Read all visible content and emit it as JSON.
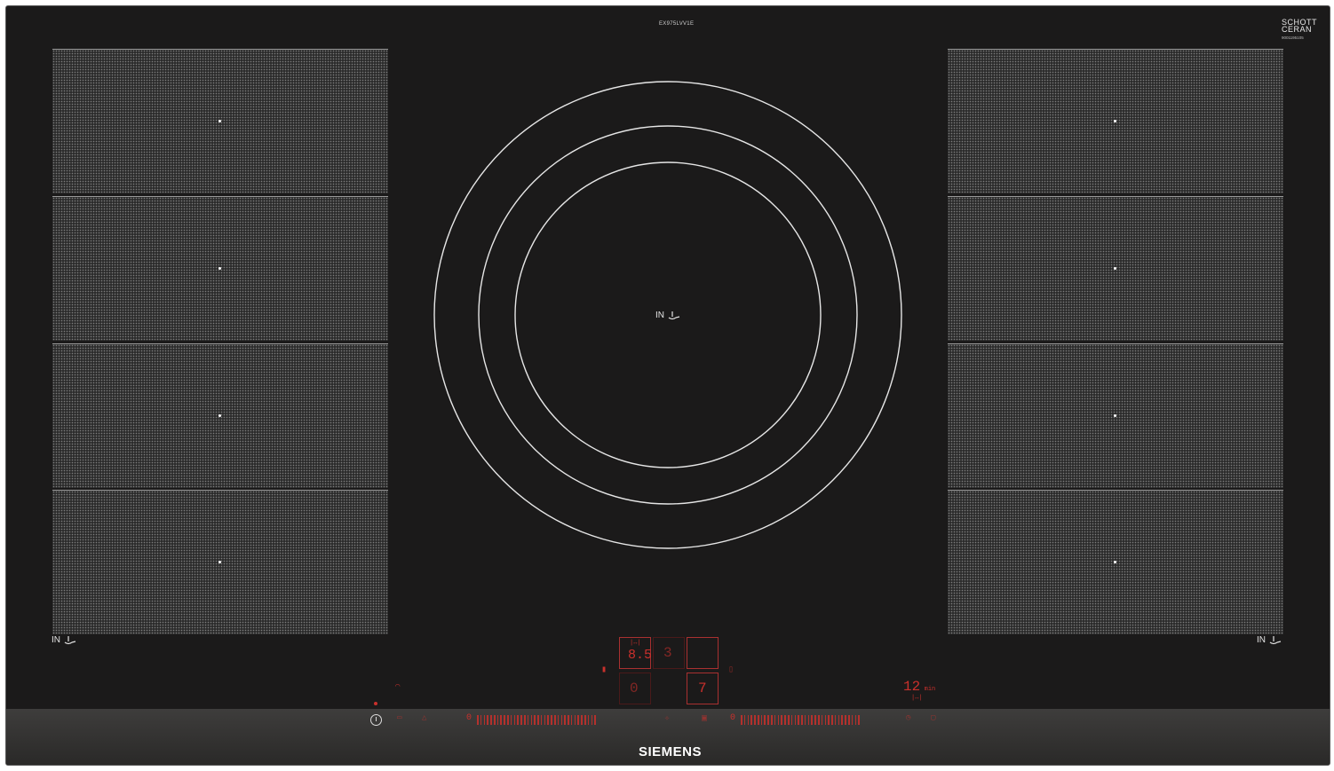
{
  "hob": {
    "model": "EX975LVV1E",
    "glass_brand": {
      "line1": "SCHOTT",
      "line2": "CERAN",
      "serial": "9001195105"
    },
    "zone_label": "IN",
    "icon_steam": "pot-steam-icon",
    "colors": {
      "glass": "#1b1a1a",
      "zone_pattern": "#7d7d7d",
      "display_red": "#c9302c",
      "circle": "#e6e6e6"
    }
  },
  "displays": {
    "level_a": "8.5",
    "level_b": "3",
    "level_c": "0",
    "level_d": "7",
    "timer_value": "12",
    "timer_unit": "min"
  },
  "sliders": {
    "left_start": "0",
    "right_start": "0"
  },
  "brand_logo": "SIEMENS"
}
